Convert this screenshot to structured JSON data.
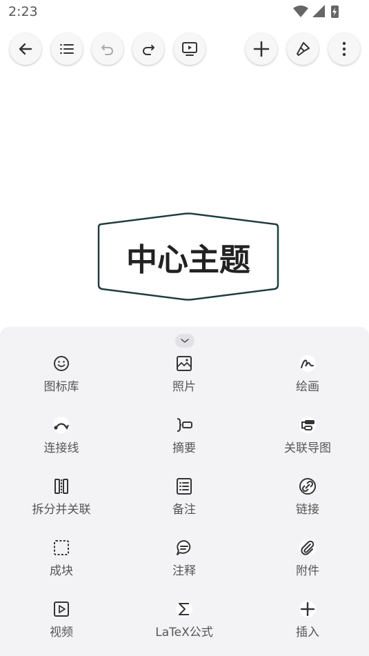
{
  "status": {
    "time": "2:23"
  },
  "toolbar": {
    "buttons": [
      {
        "name": "back",
        "icon": "back-arrow-icon"
      },
      {
        "name": "outline",
        "icon": "list-icon"
      },
      {
        "name": "undo",
        "icon": "undo-icon"
      },
      {
        "name": "redo",
        "icon": "redo-icon"
      },
      {
        "name": "present",
        "icon": "present-icon"
      },
      {
        "name": "add",
        "icon": "plus-icon"
      },
      {
        "name": "format",
        "icon": "brush-icon"
      },
      {
        "name": "more",
        "icon": "more-vertical-icon"
      }
    ]
  },
  "canvas": {
    "central_topic": "中心主题",
    "topic_border_color": "#1f3d3f"
  },
  "panel": {
    "tools": [
      {
        "label": "图标库",
        "icon": "smiley-icon"
      },
      {
        "label": "照片",
        "icon": "photo-icon"
      },
      {
        "label": "绘画",
        "icon": "draw-icon"
      },
      {
        "label": "连接线",
        "icon": "connection-line-icon"
      },
      {
        "label": "摘要",
        "icon": "summary-icon"
      },
      {
        "label": "关联导图",
        "icon": "linked-map-icon"
      },
      {
        "label": "拆分并关联",
        "icon": "split-icon"
      },
      {
        "label": "备注",
        "icon": "note-icon"
      },
      {
        "label": "链接",
        "icon": "link-icon"
      },
      {
        "label": "成块",
        "icon": "boundary-icon"
      },
      {
        "label": "注释",
        "icon": "comment-icon"
      },
      {
        "label": "附件",
        "icon": "attachment-icon"
      },
      {
        "label": "视频",
        "icon": "video-icon"
      },
      {
        "label": "LaTeX公式",
        "icon": "sigma-icon"
      },
      {
        "label": "插入",
        "icon": "insert-plus-icon"
      }
    ]
  }
}
